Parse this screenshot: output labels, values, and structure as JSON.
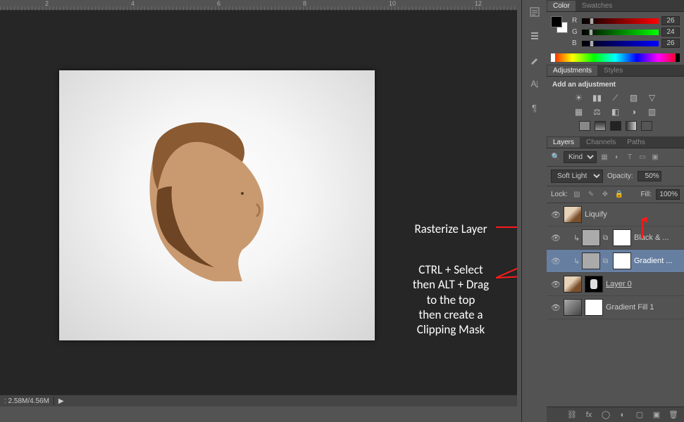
{
  "ruler": {
    "marks": [
      "2",
      "4",
      "6",
      "8",
      "10",
      "12"
    ]
  },
  "status": {
    "doc": ": 2.58M/4.56M"
  },
  "panels": {
    "color": {
      "tabs": [
        "Color",
        "Swatches"
      ],
      "channels": [
        {
          "label": "R",
          "value": "26",
          "gradient": "linear-gradient(to right, #000, #ff0000)"
        },
        {
          "label": "G",
          "value": "24",
          "gradient": "linear-gradient(to right, #000, #00ff00)"
        },
        {
          "label": "B",
          "value": "26",
          "gradient": "linear-gradient(to right, #000, #0000ff)"
        }
      ]
    },
    "adjustments": {
      "tabs": [
        "Adjustments",
        "Styles"
      ],
      "heading": "Add an adjustment"
    },
    "layers": {
      "tabs": [
        "Layers",
        "Channels",
        "Paths"
      ],
      "filter_kind": "Kind",
      "blend_mode": "Soft Light",
      "opacity_label": "Opacity:",
      "opacity_value": "50%",
      "lock_label": "Lock:",
      "fill_label": "Fill:",
      "fill_value": "100%",
      "items": [
        {
          "name": "Liquify",
          "indent": false,
          "mask": false,
          "clip": false,
          "selected": false,
          "underline": false,
          "thumb": "img"
        },
        {
          "name": "Black & ...",
          "indent": true,
          "mask": true,
          "clip": true,
          "selected": false,
          "underline": false,
          "thumb": "adj"
        },
        {
          "name": "Gradient ...",
          "indent": true,
          "mask": true,
          "clip": true,
          "selected": true,
          "underline": false,
          "thumb": "adj"
        },
        {
          "name": "Layer 0",
          "indent": false,
          "mask": true,
          "clip": false,
          "selected": false,
          "underline": true,
          "thumb": "img",
          "mask_black": true
        },
        {
          "name": "Gradient Fill 1",
          "indent": false,
          "mask": true,
          "clip": false,
          "selected": false,
          "underline": false,
          "thumb": "grad"
        }
      ]
    }
  },
  "annotations": {
    "rasterize": "Rasterize Layer",
    "instruction": "CTRL + Select\nthen ALT + Drag\nto the top\nthen create a\nClipping Mask"
  }
}
